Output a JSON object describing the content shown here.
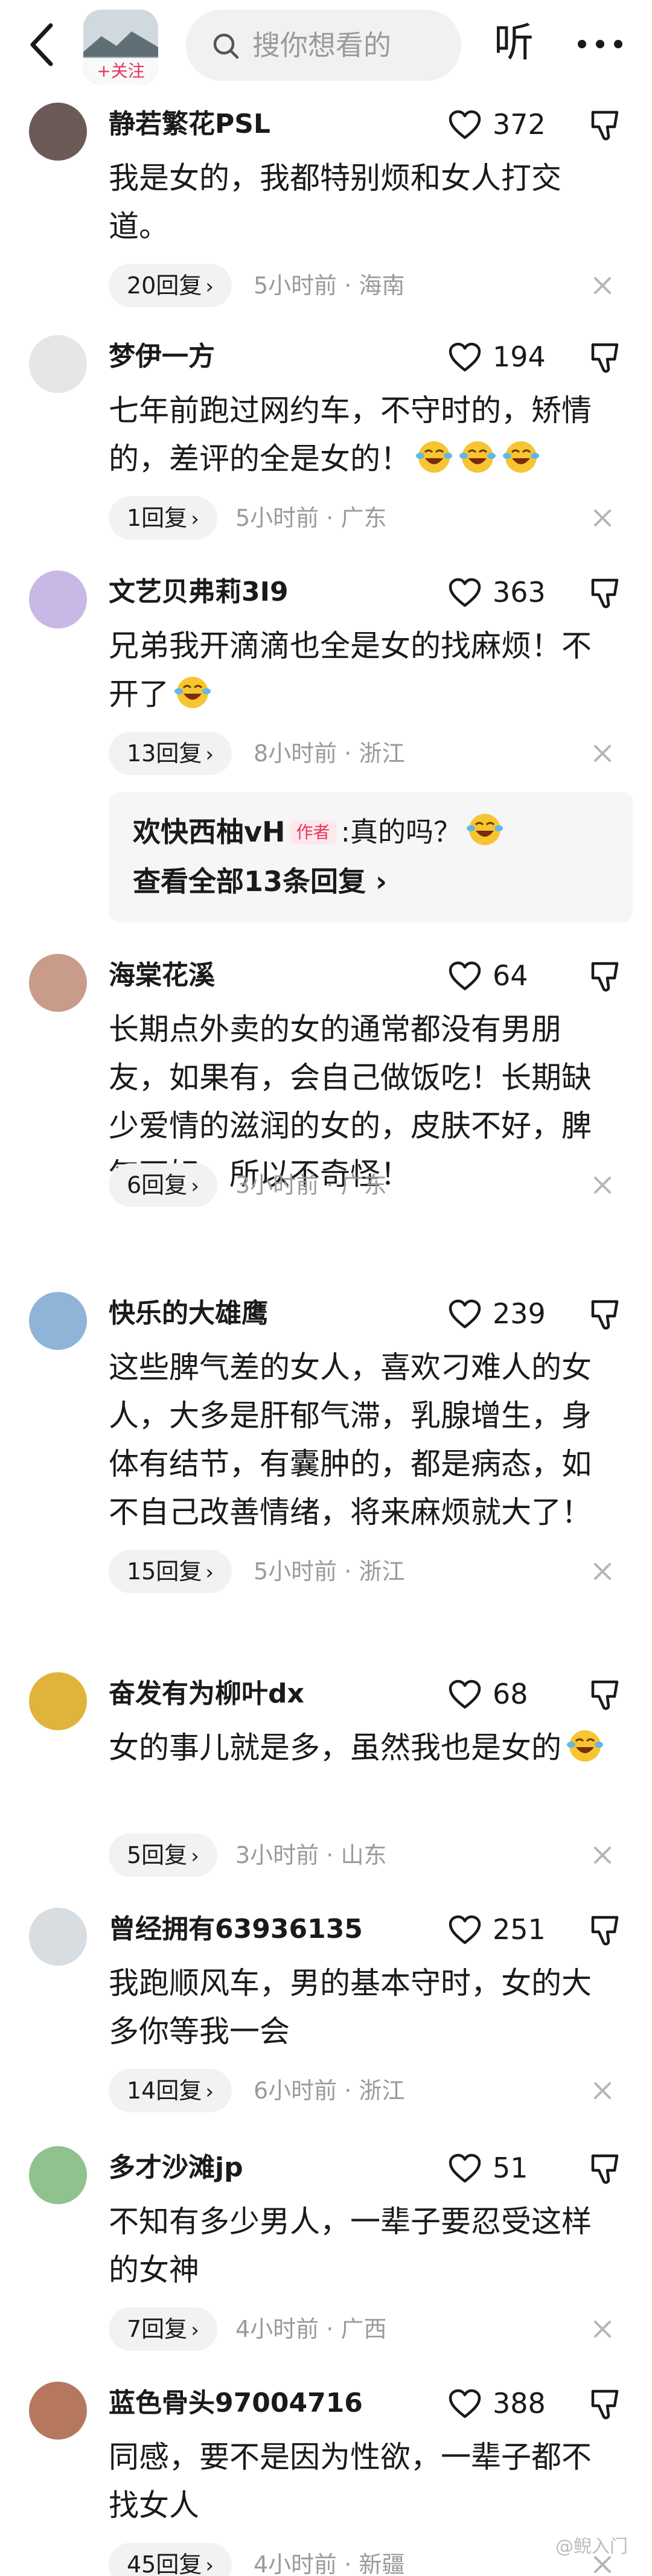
{
  "header": {
    "follow_label": "+关注",
    "search_placeholder": "搜你想看的",
    "listen_label": "听"
  },
  "comments": [
    {
      "name": "静若繁花PSL",
      "likes": "372",
      "text": "我是女的，我都特别烦和女人打交道。",
      "replies": "20回复",
      "time": "5小时前",
      "location": "海南"
    },
    {
      "name": "梦伊一方",
      "likes": "194",
      "text": "七年前跑过网约车，不守时的，矫情的，差评的全是女的！",
      "replies": "1回复",
      "time": "5小时前",
      "location": "广东"
    },
    {
      "name": "文艺贝弗莉3I9",
      "likes": "363",
      "text": "兄弟我开滴滴也全是女的找麻烦！不开了",
      "replies": "13回复",
      "time": "8小时前",
      "location": "浙江",
      "subreply": {
        "name": "欢快西柚vH",
        "tag": "作者",
        "text": ":真的吗？",
        "view_all": "查看全部13条回复"
      }
    },
    {
      "name": "海棠花溪",
      "likes": "64",
      "text": "长期点外卖的女的通常都没有男朋友，如果有，会自己做饭吃！长期缺少爱情的滋润的女的，皮肤不好，脾气不好，所以不奇怪！",
      "replies": "6回复",
      "time": "3小时前",
      "location": "广东"
    },
    {
      "name": "快乐的大雄鹰",
      "likes": "239",
      "text": "这些脾气差的女人，喜欢刁难人的女人，大多是肝郁气滞，乳腺增生，身体有结节，有囊肿的，都是病态，如不自己改善情绪，将来麻烦就大了！",
      "replies": "15回复",
      "time": "5小时前",
      "location": "浙江"
    },
    {
      "name": "奋发有为柳叶dx",
      "likes": "68",
      "text": "女的事儿就是多，虽然我也是女的",
      "replies": "5回复",
      "time": "3小时前",
      "location": "山东"
    },
    {
      "name": "曾经拥有63936135",
      "likes": "251",
      "text": "我跑顺风车，男的基本守时，女的大多你等我一会",
      "replies": "14回复",
      "time": "6小时前",
      "location": "浙江"
    },
    {
      "name": "多才沙滩jp",
      "likes": "51",
      "text": "不知有多少男人，一辈子要忍受这样的女神",
      "replies": "7回复",
      "time": "4小时前",
      "location": "广西"
    },
    {
      "name": "蓝色骨头97004716",
      "likes": "388",
      "text": "同感，要不是因为性欲，一辈子都不找女人",
      "replies": "45回复",
      "time": "4小时前",
      "location": "新疆"
    }
  ],
  "watermark": "@鲵入门"
}
